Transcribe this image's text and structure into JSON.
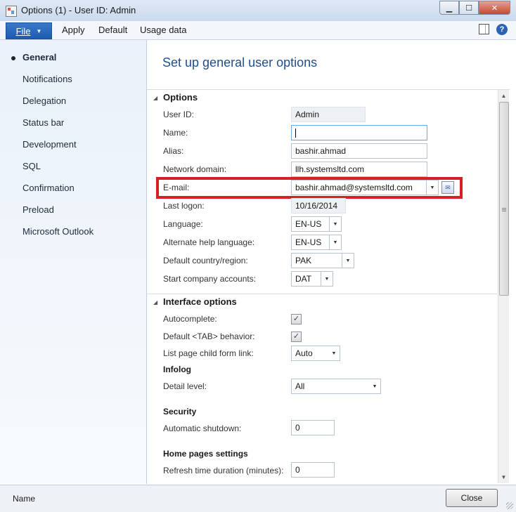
{
  "window": {
    "title": "Options (1) - User ID: Admin",
    "controls": {
      "minimize": "▁",
      "maximize": "☐",
      "close": "✕"
    }
  },
  "menubar": {
    "file_label": "File",
    "items": [
      "Apply",
      "Default",
      "Usage data"
    ],
    "icons": [
      "layout-icon",
      "help-icon"
    ],
    "help_glyph": "?"
  },
  "nav": {
    "items": [
      "General",
      "Notifications",
      "Delegation",
      "Status bar",
      "Development",
      "SQL",
      "Confirmation",
      "Preload",
      "Microsoft Outlook"
    ],
    "active": "General"
  },
  "page": {
    "title": "Set up general user options"
  },
  "options": {
    "header": "Options",
    "user_id": {
      "label": "User ID:",
      "value": "Admin"
    },
    "name": {
      "label": "Name:",
      "value": ""
    },
    "alias": {
      "label": "Alias:",
      "value": "bashir.ahmad"
    },
    "network_domain": {
      "label": "Network domain:",
      "value": "llh.systemsltd.com"
    },
    "email": {
      "label": "E-mail:",
      "value": "bashir.ahmad@systemsltd.com"
    },
    "last_logon": {
      "label": "Last logon:",
      "value": "10/16/2014"
    },
    "language": {
      "label": "Language:",
      "value": "EN-US"
    },
    "alt_help_language": {
      "label": "Alternate help language:",
      "value": "EN-US"
    },
    "default_country": {
      "label": "Default country/region:",
      "value": "PAK"
    },
    "start_company": {
      "label": "Start company accounts:",
      "value": "DAT"
    }
  },
  "interface": {
    "header": "Interface options",
    "autocomplete": {
      "label": "Autocomplete:",
      "checked": true
    },
    "tab_behavior": {
      "label": "Default <TAB> behavior:",
      "checked": true
    },
    "child_form_link": {
      "label": "List page child form link:",
      "value": "Auto"
    },
    "infolog_header": "Infolog",
    "detail_level": {
      "label": "Detail level:",
      "value": "All"
    },
    "security_header": "Security",
    "auto_shutdown": {
      "label": "Automatic shutdown:",
      "value": "0"
    },
    "home_header": "Home pages settings",
    "refresh_time": {
      "label": "Refresh time duration (minutes):",
      "value": "0"
    }
  },
  "statusbar": {
    "name_label": "Name",
    "close_label": "Close"
  },
  "colors": {
    "accent": "#1d5bb0",
    "title_blue": "#1f4e8f",
    "highlight_red": "#d71f26"
  }
}
